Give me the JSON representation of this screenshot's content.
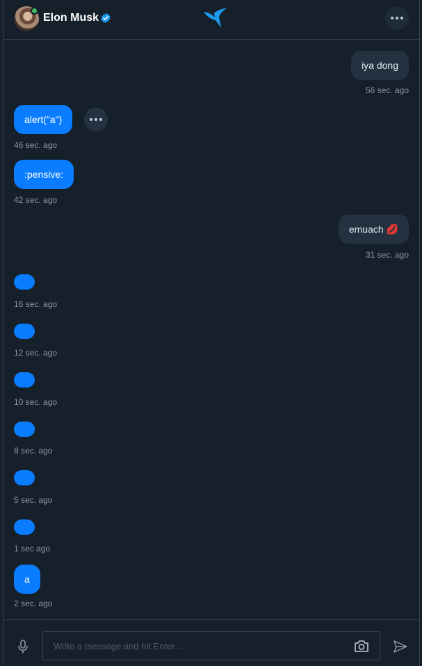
{
  "header": {
    "user_name": "Elon Musk",
    "verified": true,
    "online": true,
    "more_icon": "more-horizontal-icon",
    "logo_icon": "hummingbird-logo-icon"
  },
  "messages": [
    {
      "direction": "in",
      "text": "iya dong",
      "time": "56 sec. ago"
    },
    {
      "direction": "out",
      "text": "alert(\"a\")",
      "time": "46 sec. ago",
      "has_menu": true
    },
    {
      "direction": "out",
      "text": ":pensive:",
      "time": "42 sec. ago"
    },
    {
      "direction": "in",
      "text": "emuach 💋",
      "time": "31 sec. ago"
    },
    {
      "direction": "out",
      "text": "",
      "time": "16 sec. ago"
    },
    {
      "direction": "out",
      "text": "",
      "time": "12 sec. ago"
    },
    {
      "direction": "out",
      "text": "",
      "time": "10 sec. ago"
    },
    {
      "direction": "out",
      "text": "",
      "time": "8 sec. ago"
    },
    {
      "direction": "out",
      "text": "",
      "time": "5 sec. ago"
    },
    {
      "direction": "out",
      "text": "",
      "time": "1 sec ago"
    },
    {
      "direction": "out",
      "text": "a",
      "time": "2 sec. ago"
    }
  ],
  "composer": {
    "placeholder": "Write a message and hit Enter ...",
    "value": "",
    "mic_icon": "microphone-icon",
    "camera_icon": "camera-icon",
    "send_icon": "send-icon"
  },
  "colors": {
    "background": "#16202b",
    "outgoing_bubble": "#0a7cff",
    "incoming_bubble": "#243140",
    "border": "#38444d",
    "timestamp": "#8b98a5",
    "online": "#3fbd61",
    "brand": "#1d9bf0"
  }
}
